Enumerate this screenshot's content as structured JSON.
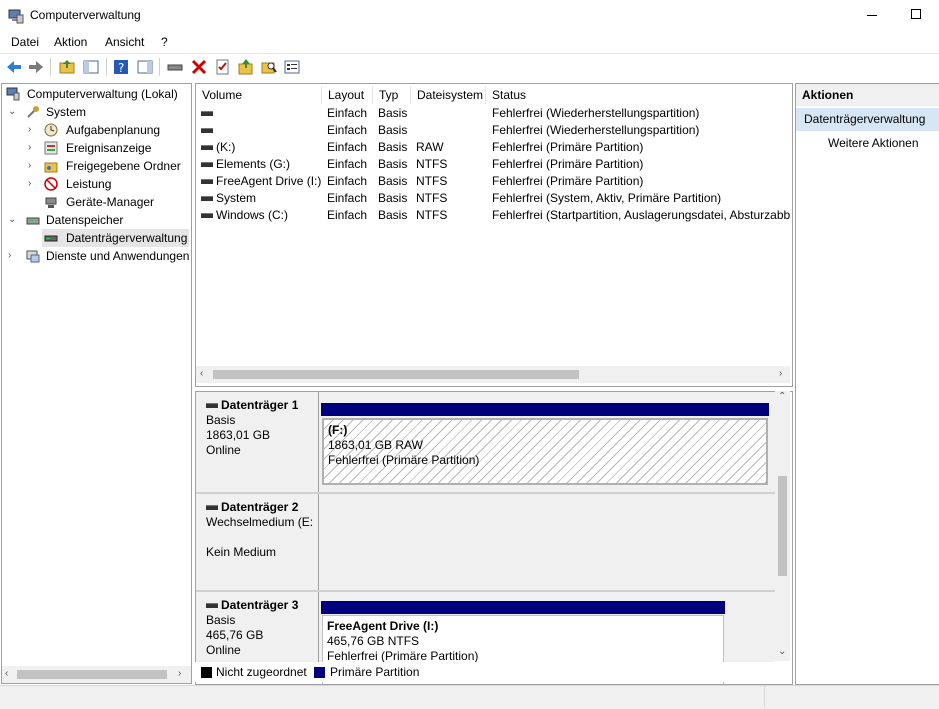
{
  "window": {
    "title": "Computerverwaltung"
  },
  "menu": [
    "Datei",
    "Aktion",
    "Ansicht",
    "?"
  ],
  "toolbar": {
    "icons": [
      "back-icon",
      "forward-icon",
      "up-folder-icon",
      "show-hide-tree-icon",
      "help-icon",
      "properties-pane-icon",
      "connect-icon",
      "delete-icon",
      "properties-icon",
      "import-icon",
      "search-icon",
      "settings-icon"
    ]
  },
  "tree": {
    "root": "Computerverwaltung (Lokal)",
    "system": "System",
    "items_system": [
      "Aufgabenplanung",
      "Ereignisanzeige",
      "Freigegebene Ordner",
      "Leistung",
      "Geräte-Manager"
    ],
    "storage": "Datenspeicher",
    "items_storage": [
      "Datenträgerverwaltung"
    ],
    "services": "Dienste und Anwendungen"
  },
  "volumes": {
    "headers": [
      "Volume",
      "Layout",
      "Typ",
      "Dateisystem",
      "Status"
    ],
    "rows": [
      [
        "",
        "Einfach",
        "Basis",
        "",
        "Fehlerfrei (Wiederherstellungspartition)"
      ],
      [
        "",
        "Einfach",
        "Basis",
        "",
        "Fehlerfrei (Wiederherstellungspartition)"
      ],
      [
        "(K:)",
        "Einfach",
        "Basis",
        "RAW",
        "Fehlerfrei (Primäre Partition)"
      ],
      [
        "Elements (G:)",
        "Einfach",
        "Basis",
        "NTFS",
        "Fehlerfrei (Primäre Partition)"
      ],
      [
        "FreeAgent Drive (I:)",
        "Einfach",
        "Basis",
        "NTFS",
        "Fehlerfrei (Primäre Partition)"
      ],
      [
        "System",
        "Einfach",
        "Basis",
        "NTFS",
        "Fehlerfrei (System, Aktiv, Primäre Partition)"
      ],
      [
        "Windows (C:)",
        "Einfach",
        "Basis",
        "NTFS",
        "Fehlerfrei (Startpartition, Auslagerungsdatei, Absturzabbi"
      ]
    ]
  },
  "disks": [
    {
      "name": "Datenträger 1",
      "type": "Basis",
      "size": "1863,01 GB",
      "state": "Online",
      "partition": {
        "label": "(F:)",
        "size": "1863,01 GB RAW",
        "status": "Fehlerfrei (Primäre Partition)"
      }
    },
    {
      "name": "Datenträger 2",
      "type": "Wechselmedium (E:",
      "size": "",
      "state": "Kein Medium"
    },
    {
      "name": "Datenträger 3",
      "type": "Basis",
      "size": "465,76 GB",
      "state": "Online",
      "partition": {
        "label": "FreeAgent Drive  (I:)",
        "size": "465,76 GB NTFS",
        "status": "Fehlerfrei (Primäre Partition)"
      }
    }
  ],
  "legend": {
    "unallocated": "Nicht zugeordnet",
    "primary": "Primäre Partition",
    "unallocated_color": "#000000",
    "primary_color": "#00007f"
  },
  "actions": {
    "header": "Aktionen",
    "selected": "Datenträgerverwaltung",
    "more": "Weitere Aktionen"
  }
}
